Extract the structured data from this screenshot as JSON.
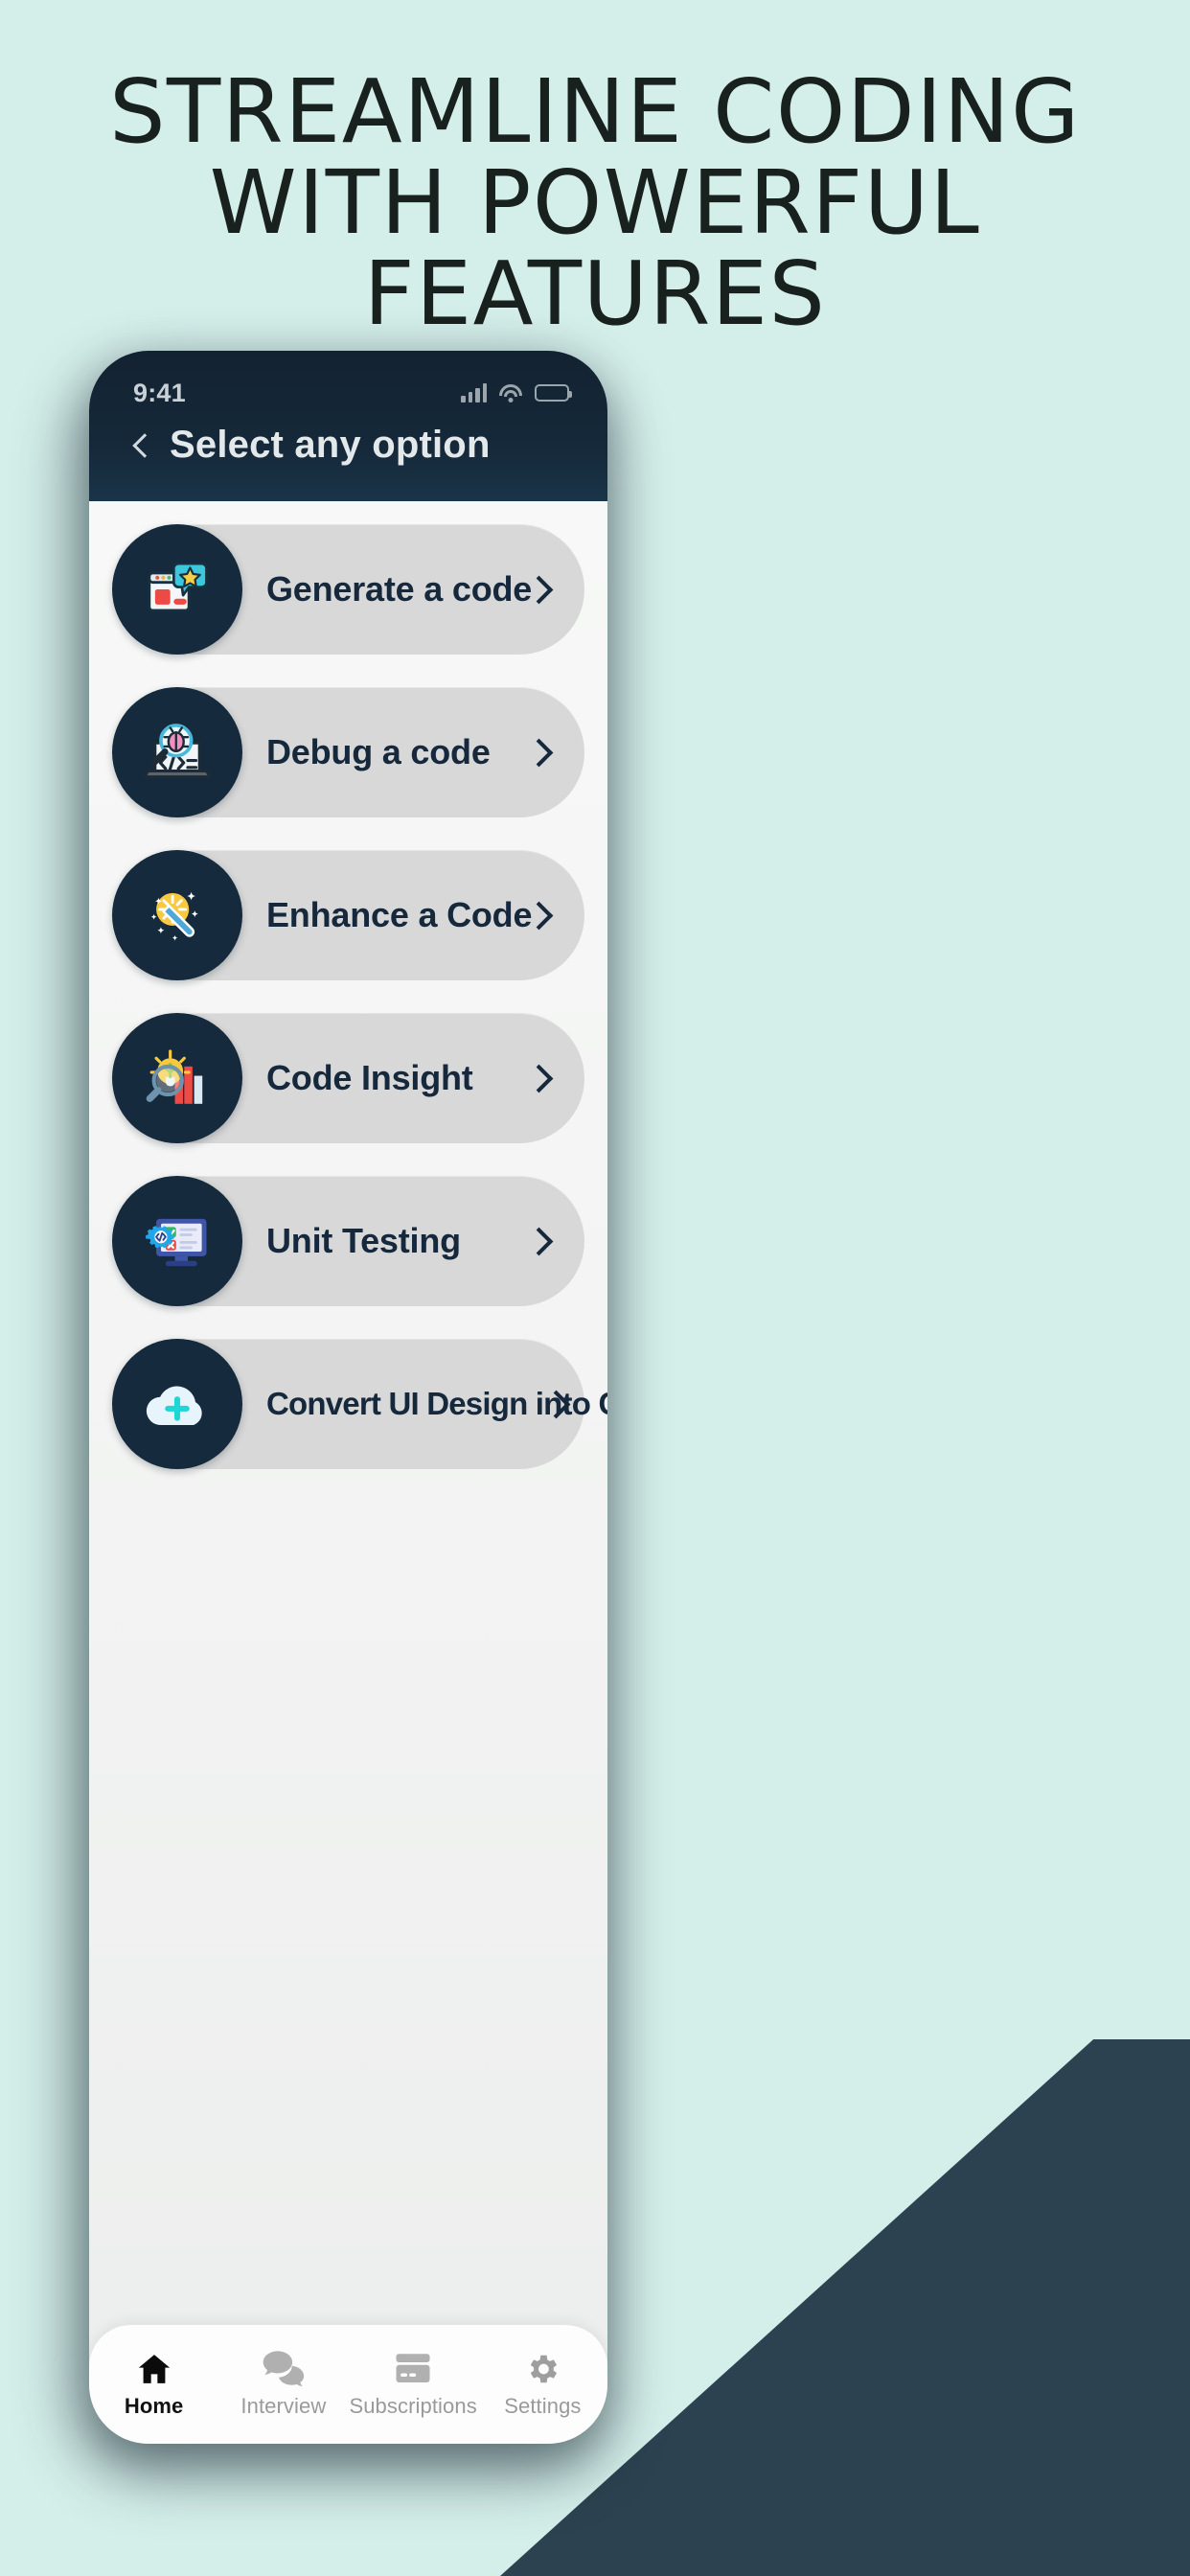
{
  "promo": {
    "headline_lines": [
      "STREAMLINE CODING",
      "WITH POWERFUL",
      "FEATURES"
    ],
    "background_color": "#d4eeea",
    "accent_dark": "#2c4250"
  },
  "phone": {
    "status_bar": {
      "time": "9:41",
      "cellular_icon": "signal-bars-icon",
      "wifi_icon": "wifi-icon",
      "battery_icon": "battery-icon",
      "battery_color": "#f5c12a"
    },
    "header": {
      "back_icon": "chevron-left-icon",
      "title": "Select any option",
      "background_color": "#15293a"
    },
    "options": [
      {
        "label": "Generate a code",
        "icon": "code-window-star-icon",
        "chevron": "chevron-right-icon"
      },
      {
        "label": "Debug a code",
        "icon": "laptop-bug-magnifier-icon",
        "chevron": "chevron-right-icon"
      },
      {
        "label": "Enhance  a Code",
        "icon": "magic-wand-sparkle-icon",
        "chevron": "chevron-right-icon"
      },
      {
        "label": "Code Insight",
        "icon": "lightbulb-chart-magnifier-icon",
        "chevron": "chevron-right-icon"
      },
      {
        "label": "Unit Testing",
        "icon": "monitor-check-cross-gear-icon",
        "chevron": "chevron-right-icon"
      },
      {
        "label": "Convert UI Design into Code",
        "icon": "cloud-plus-icon",
        "chevron": "chevron-right-icon"
      }
    ],
    "tabs": [
      {
        "label": "Home",
        "icon": "home-icon",
        "active": true
      },
      {
        "label": "Interview",
        "icon": "chat-bubbles-icon",
        "active": false
      },
      {
        "label": "Subscriptions",
        "icon": "credit-card-icon",
        "active": false
      },
      {
        "label": "Settings",
        "icon": "gear-icon",
        "active": false
      }
    ]
  }
}
